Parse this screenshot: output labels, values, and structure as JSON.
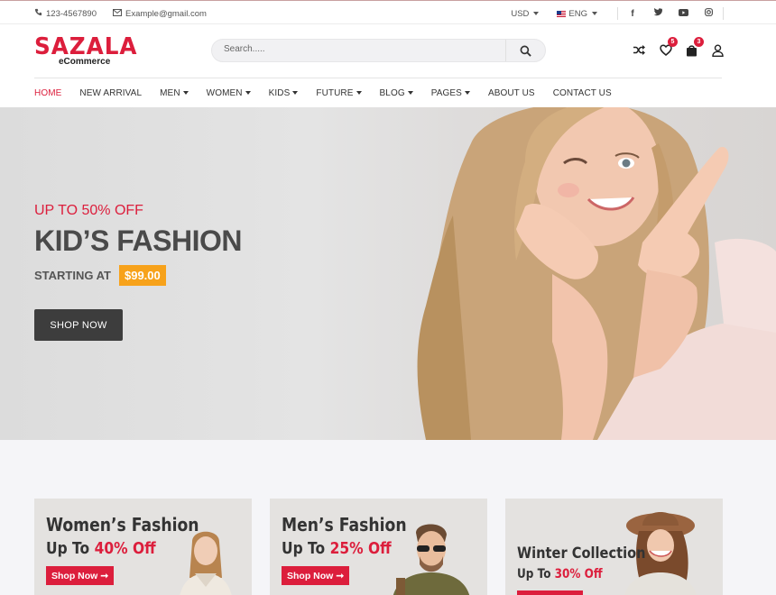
{
  "topbar": {
    "phone": "123-4567890",
    "email": "Example@gmail.com",
    "currency": "USD",
    "language": "ENG",
    "social": [
      "f",
      "t",
      "▶",
      "◎"
    ]
  },
  "header": {
    "brand": "SAZALA",
    "tagline": "eCommerce",
    "search_placeholder": "Search.....",
    "wishlist_count": "5",
    "cart_count": "3"
  },
  "nav": {
    "items": [
      {
        "label": "HOME",
        "dropdown": false,
        "active": true
      },
      {
        "label": "NEW ARRIVAL",
        "dropdown": false
      },
      {
        "label": "MEN",
        "dropdown": true
      },
      {
        "label": "WOMEN",
        "dropdown": true
      },
      {
        "label": "KIDS",
        "dropdown": true
      },
      {
        "label": "FUTURE",
        "dropdown": true
      },
      {
        "label": "BLOG",
        "dropdown": true
      },
      {
        "label": "PAGES",
        "dropdown": true
      },
      {
        "label": "ABOUT US",
        "dropdown": false
      },
      {
        "label": "CONTACT US",
        "dropdown": false
      }
    ]
  },
  "hero": {
    "promo": "UP TO 50% OFF",
    "title": "KID’S FASHION",
    "starting_label": "STARTING AT",
    "price": "$99.00",
    "button": "SHOP NOW"
  },
  "categories": [
    {
      "title": "Women’s Fashion",
      "prefix": "Up To ",
      "discount": "40% Off",
      "button": "Shop Now"
    },
    {
      "title": "Men’s Fashion",
      "prefix": "Up To ",
      "discount": "25% Off",
      "button": "Shop Now"
    },
    {
      "title": "Winter Collection",
      "prefix": "Up To ",
      "discount": "30% Off",
      "button": ""
    }
  ],
  "colors": {
    "accent": "#dc1e3c",
    "price_badge": "#f7a21b",
    "dark_button": "#3d3d3d"
  }
}
